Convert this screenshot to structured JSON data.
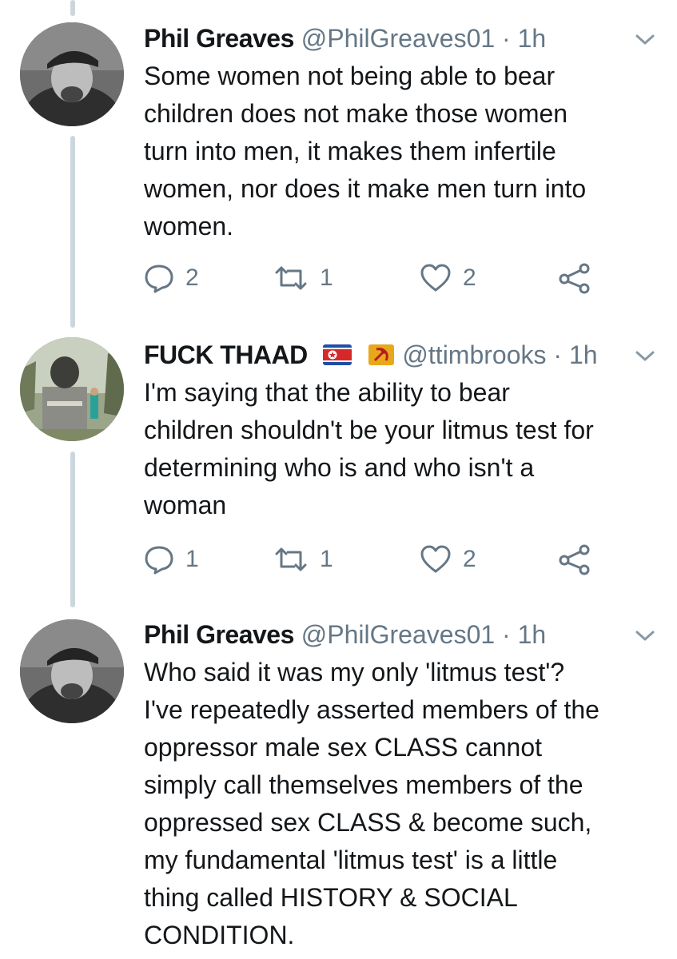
{
  "tweets": [
    {
      "name": "Phil Greaves",
      "handle": "@PhilGreaves01",
      "separator": "·",
      "time": "1h",
      "lines": [
        "Some women not being able to bear",
        "children does not make those women",
        "turn into men, it makes them infertile",
        "women, nor does it make men turn into",
        "women."
      ],
      "replies": "2",
      "retweets": "1",
      "likes": "2"
    },
    {
      "name": "FUCK THAAD",
      "name_flags": [
        "north-korea-flag-icon",
        "hammer-sickle-flag-icon"
      ],
      "handle": "@ttimbrooks",
      "separator": "·",
      "time": "1h",
      "lines": [
        "I'm saying that the ability to bear",
        "children shouldn't be your litmus test for",
        "determining who is and who isn't a",
        "woman"
      ],
      "replies": "1",
      "retweets": "1",
      "likes": "2"
    },
    {
      "name": "Phil Greaves",
      "handle": "@PhilGreaves01",
      "separator": "·",
      "time": "1h",
      "lines": [
        "Who said it was my only 'litmus test'?",
        "I've repeatedly asserted members of the",
        "oppressor male sex CLASS cannot",
        "simply call themselves members of the",
        "oppressed sex CLASS & become such,",
        "my fundamental 'litmus test' is a little",
        "thing called HISTORY & SOCIAL",
        "CONDITION."
      ]
    }
  ],
  "colors": {
    "text": "#14171a",
    "muted": "#657786",
    "thread_line": "#ccd6dd",
    "icon": "#657786"
  },
  "icons": [
    "reply-icon",
    "retweet-icon",
    "like-icon",
    "share-icon",
    "chevron-down-icon"
  ]
}
